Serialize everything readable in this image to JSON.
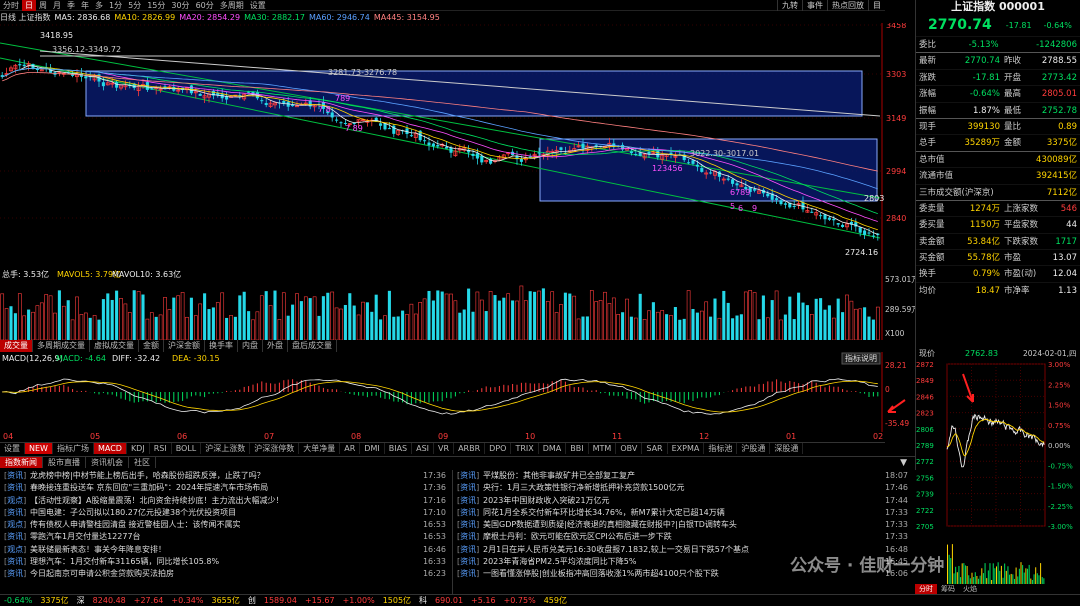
{
  "toolbar": {
    "periods": [
      "分时",
      "日",
      "周",
      "月",
      "季",
      "年",
      "多",
      "1分",
      "5分",
      "15分",
      "30分",
      "60分",
      "多周期",
      "设置"
    ],
    "active_period": 1,
    "right_buttons": [
      "九转",
      "事件",
      "热点回放",
      "目"
    ]
  },
  "ma_legend": {
    "label": "日线 上证指数",
    "items": [
      {
        "text": "MA5: 2836.68",
        "color": "#eeeeee"
      },
      {
        "text": "MA10: 2826.99",
        "color": "#ffd400"
      },
      {
        "text": "MA20: 2854.29",
        "color": "#ff4fff"
      },
      {
        "text": "MA30: 2882.17",
        "color": "#00e060"
      },
      {
        "text": "MA60: 2946.74",
        "color": "#5aa0ff"
      },
      {
        "text": "MA445: 3154.95",
        "color": "#ff8080"
      }
    ]
  },
  "main_chart": {
    "price_axis": [
      "3458",
      "3303",
      "3149",
      "2994",
      "2840"
    ],
    "annotations": {
      "high": "3418.95",
      "range1": "3356.12-3349.72",
      "range2": "3281.73-3276.78",
      "range3": "3022.30-3017.01",
      "low": "2724.16",
      "last": "2803",
      "td_marks": [
        "789",
        "7 8",
        "7 89",
        "123456",
        "6789",
        "5",
        "6",
        "9"
      ]
    },
    "months": [
      "04",
      "05",
      "06",
      "07",
      "08",
      "09",
      "10",
      "11",
      "12",
      "01",
      "02"
    ]
  },
  "volume": {
    "legend": [
      {
        "text": "总手: 3.53亿",
        "color": "#eeeeee"
      },
      {
        "text": "MAVOL5: 3.79亿",
        "color": "#ffd400"
      },
      {
        "text": "MAVOL10: 3.63亿",
        "color": "#eeeeee"
      }
    ],
    "axis": [
      "573.01万",
      "289.59万",
      "X100"
    ]
  },
  "sub_tabs": [
    "成交量",
    "多周期成交量",
    "虚拟成交量",
    "金额",
    "沪深金额",
    "换手率",
    "内盘",
    "外盘",
    "盘后成交量"
  ],
  "macd": {
    "legend": [
      {
        "text": "MACD(12,26,9)",
        "color": "#eeeeee"
      },
      {
        "text": "MACD: -4.64",
        "color": "#00e060"
      },
      {
        "text": "DIFF: -32.42",
        "color": "#eeeeee"
      },
      {
        "text": "DEA: -30.15",
        "color": "#ffd400"
      }
    ],
    "button": "指标说明",
    "axis": [
      "28.21",
      "0",
      "-35.49"
    ]
  },
  "indicator_tabs": [
    "设置",
    "NEW",
    "指标广场",
    "MACD",
    "KDJ",
    "RSI",
    "BOLL",
    "沪深上涨数",
    "沪深涨停数",
    "大单净量",
    "AR",
    "DMI",
    "BIAS",
    "ASI",
    "VR",
    "ARBR",
    "DPO",
    "TRIX",
    "DMA",
    "BBI",
    "MTM",
    "OBV",
    "SAR",
    "EXPMA",
    "指标池",
    "沪股通",
    "深股通"
  ],
  "news_tabs": [
    "指数新闻",
    "股市直播",
    "资讯机会",
    "社区"
  ],
  "news_left": [
    {
      "type": "资讯",
      "title": "龙虎榜中榜|中材节能上榜后出手，哈森股份超跌反弹，止跌了吗？",
      "time": "17:36"
    },
    {
      "type": "资讯",
      "title": "春晚接连重投送车 京东回应\"三重加码\"：2024年提速汽车市场布局",
      "time": "17:36"
    },
    {
      "type": "观点",
      "title": "【活动性观察】A股缩量震荡！北向资金持续抄底！主力流出大幅减少！",
      "time": "17:16"
    },
    {
      "type": "资讯",
      "title": "中国电建：子公司拟以180.27亿元投建38个光伏投资项目",
      "time": "17:10"
    },
    {
      "type": "观点",
      "title": "传有债权人申请警桂园清盘 接近警桂园人士：该传闻不属实",
      "time": "16:53"
    },
    {
      "type": "资讯",
      "title": "零跑汽车1月交付量达12277台",
      "time": "16:53"
    },
    {
      "type": "观点",
      "title": "美联储最新表态！事关今年降息安排！",
      "time": "16:46"
    },
    {
      "type": "资讯",
      "title": "理想汽车：1月交付新车31165辆，同比增长105.8%",
      "time": "16:33"
    },
    {
      "type": "资讯",
      "title": "今日起南京可申请公积金贷款购买法拍房",
      "time": "16:23"
    }
  ],
  "news_right": [
    {
      "type": "资讯",
      "title": "平煤股份：其他非事故矿井已全部复工复产",
      "time": "18:07"
    },
    {
      "type": "资讯",
      "title": "央行：1月三大政策性银行净新增抵押补充贷款1500亿元",
      "time": "17:46"
    },
    {
      "type": "资讯",
      "title": "2023年中国财政收入突破21万亿元",
      "time": "17:44"
    },
    {
      "type": "资讯",
      "title": "同花1月全系交付新车环比增长34.76%，新M7累计大定已超14万辆",
      "time": "17:33"
    },
    {
      "type": "资讯",
      "title": "美国GDP数据遭到质疑|经济衰退的真相隐藏在财报中?|白银TD调转车头",
      "time": "17:33"
    },
    {
      "type": "资讯",
      "title": "摩根士丹利：欧元可能在欧元区CPI公布后进一步下跌",
      "time": "17:33"
    },
    {
      "type": "资讯",
      "title": "2月1日在岸人民币兑美元16:30收盘报7.1832,较上一交易日下跌57个基点",
      "time": "16:48"
    },
    {
      "type": "资讯",
      "title": "2023年青海省PM2.5平均浓度同比下降5%",
      "time": "16:45"
    },
    {
      "type": "资讯",
      "title": "一图看懂涨停股|创业板指冲高回落收涨1%两市超4100只个股下跌",
      "time": "16:06"
    }
  ],
  "status_bar": [
    {
      "text": "-0.64%",
      "color": "#00e060"
    },
    {
      "text": "3375亿",
      "color": "#ffd400"
    },
    {
      "text": "深",
      "color": "#eeeeee"
    },
    {
      "text": "8240.48",
      "color": "#ff3c3c"
    },
    {
      "text": "+27.64",
      "color": "#ff3c3c"
    },
    {
      "text": "+0.34%",
      "color": "#ff3c3c"
    },
    {
      "text": "3655亿",
      "color": "#ffd400"
    },
    {
      "text": "创",
      "color": "#eeeeee"
    },
    {
      "text": "1589.04",
      "color": "#ff3c3c"
    },
    {
      "text": "+15.67",
      "color": "#ff3c3c"
    },
    {
      "text": "+1.00%",
      "color": "#ff3c3c"
    },
    {
      "text": "1505亿",
      "color": "#ffd400"
    },
    {
      "text": "科",
      "color": "#eeeeee"
    },
    {
      "text": "690.01",
      "color": "#ff3c3c"
    },
    {
      "text": "+5.16",
      "color": "#ff3c3c"
    },
    {
      "text": "+0.75%",
      "color": "#ff3c3c"
    },
    {
      "text": "459亿",
      "color": "#ffd400"
    }
  ],
  "quote": {
    "title": "上证指数 000001",
    "price": "2770.74",
    "change": "-17.81",
    "pct": "-0.64%",
    "rows": [
      {
        "a": "委比",
        "b": "-5.13%",
        "bc": "#00e060",
        "c": "",
        "d": "-1242806",
        "dc": "#00e060"
      },
      {
        "sep": true,
        "a": "最新",
        "b": "2770.74",
        "bc": "#00e060",
        "c": "昨收",
        "d": "2788.55",
        "dc": "#eeeeee"
      },
      {
        "a": "涨跌",
        "b": "-17.81",
        "bc": "#00e060",
        "c": "开盘",
        "d": "2773.42",
        "dc": "#00e060"
      },
      {
        "a": "涨幅",
        "b": "-0.64%",
        "bc": "#00e060",
        "c": "最高",
        "d": "2805.01",
        "dc": "#ff3c3c"
      },
      {
        "a": "振幅",
        "b": "1.87%",
        "bc": "#eeeeee",
        "c": "最低",
        "d": "2752.78",
        "dc": "#00e060"
      },
      {
        "sep": true,
        "a": "现手",
        "b": "399130",
        "bc": "#ffd400",
        "c": "量比",
        "d": "0.89",
        "dc": "#ffd400"
      },
      {
        "a": "总手",
        "b": "35289万",
        "bc": "#ffd400",
        "c": "金额",
        "d": "3375亿",
        "dc": "#ffd400"
      },
      {
        "sep": true,
        "a": "总市值",
        "b": "",
        "bc": "#eeeeee",
        "c": "",
        "d": "430089亿",
        "dc": "#ffd400"
      },
      {
        "a": "流通市值",
        "b": "",
        "bc": "#eeeeee",
        "c": "",
        "d": "392415亿",
        "dc": "#ffd400"
      },
      {
        "a": "三市成交额(沪深京)",
        "b": "",
        "bc": "#eeeeee",
        "c": "",
        "d": "7112亿",
        "dc": "#ffd400"
      },
      {
        "sep": true,
        "a": "委卖量",
        "b": "1274万",
        "bc": "#ffd400",
        "c": "上涨家数",
        "d": "546",
        "dc": "#ff3c3c"
      },
      {
        "a": "委买量",
        "b": "1150万",
        "bc": "#ffd400",
        "c": "平盘家数",
        "d": "44",
        "dc": "#eeeeee"
      },
      {
        "a": "卖金额",
        "b": "53.84亿",
        "bc": "#ffd400",
        "c": "下跌家数",
        "d": "1717",
        "dc": "#00e060"
      },
      {
        "a": "买金额",
        "b": "55.78亿",
        "bc": "#ffd400",
        "c": "市盈",
        "d": "13.07",
        "dc": "#eeeeee"
      },
      {
        "a": "换手",
        "b": "0.79%",
        "bc": "#ffd400",
        "c": "市盈(动)",
        "d": "12.04",
        "dc": "#eeeeee"
      },
      {
        "a": "均价",
        "b": "18.47",
        "bc": "#ffd400",
        "c": "市净率",
        "d": "1.13",
        "dc": "#eeeeee"
      }
    ]
  },
  "mini_chart": {
    "label": "现价",
    "price": "2762.83",
    "date": "2024-02-01,四",
    "left_axis": [
      "2872",
      "2849",
      "2846",
      "2823",
      "2806",
      "2789",
      "2772",
      "2756",
      "2739",
      "2722",
      "2705"
    ],
    "right_axis": [
      "3.00%",
      "2.25%",
      "1.50%",
      "0.75%",
      "0.00%",
      "-0.75%",
      "-1.50%",
      "-2.25%",
      "-3.00%"
    ],
    "tabs": [
      "分时",
      "筹码",
      "火焰"
    ]
  },
  "watermark": "公众号 · 佳财一分钟"
}
